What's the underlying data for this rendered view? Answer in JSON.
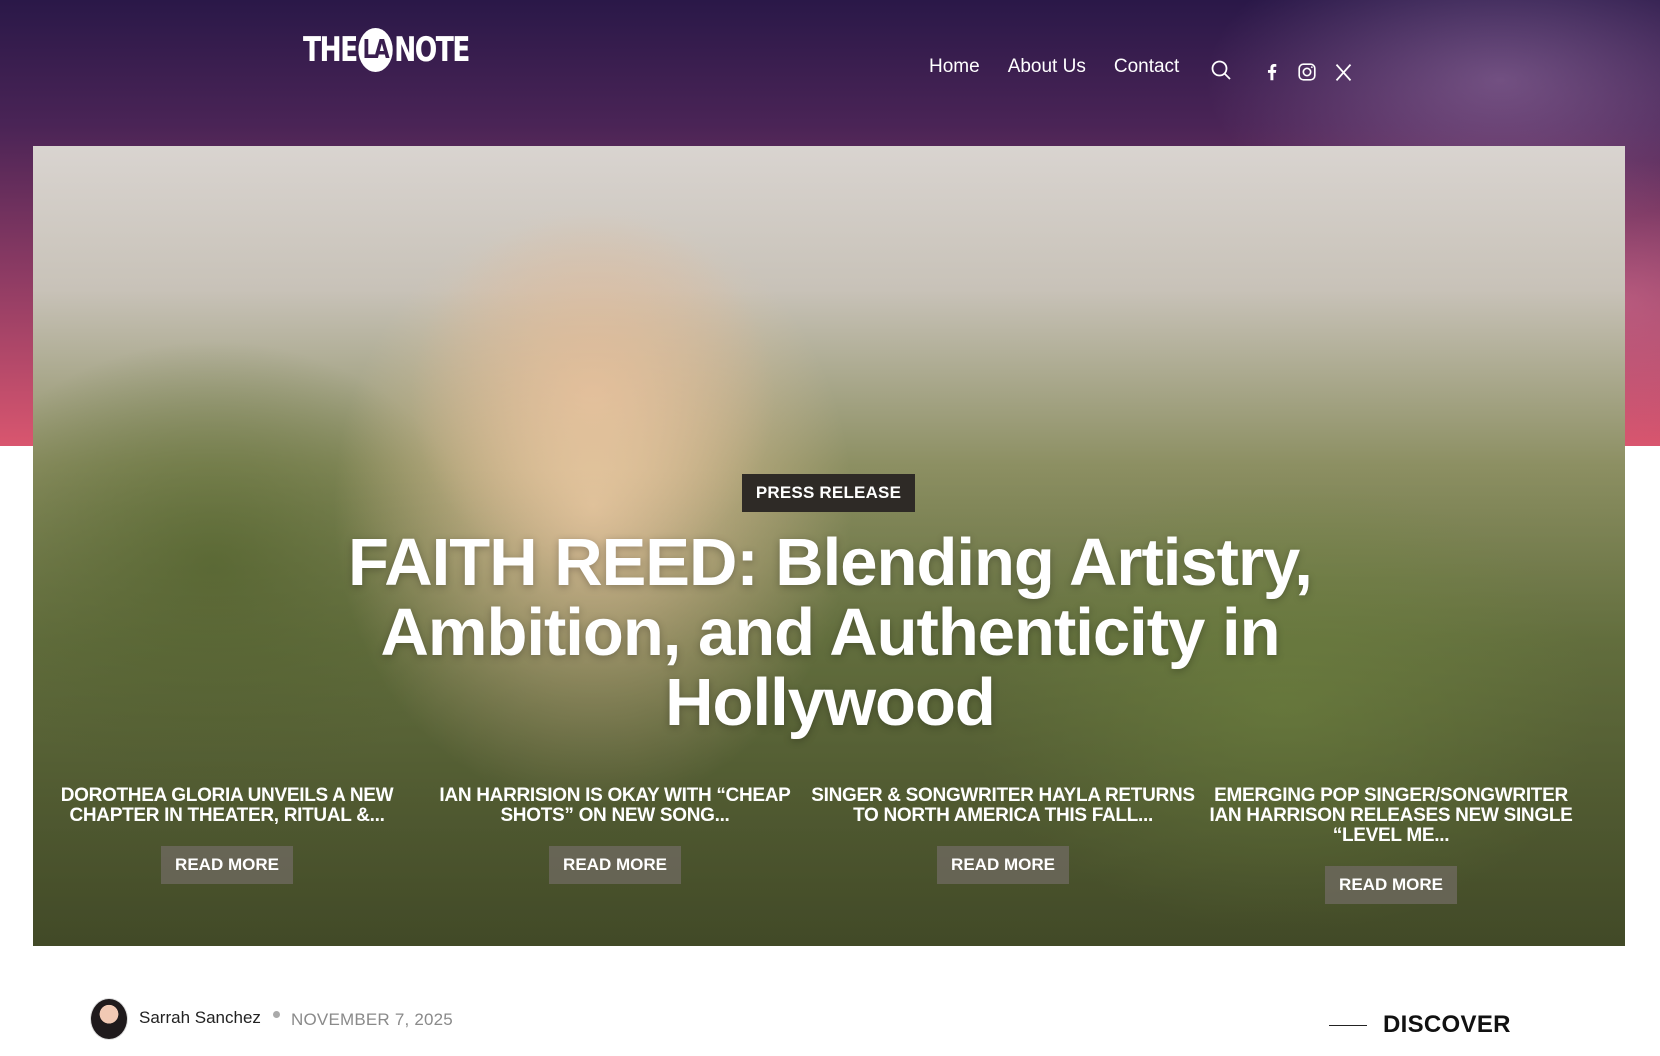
{
  "header": {
    "logo": {
      "left": "THE",
      "ring": "LA",
      "right": "NOTE"
    },
    "nav": [
      "Home",
      "About Us",
      "Contact"
    ],
    "icons": [
      "search-icon",
      "facebook-icon",
      "instagram-icon",
      "x-icon"
    ]
  },
  "hero": {
    "badge": "PRESS RELEASE",
    "title": "FAITH REED: Blending Artistry, Ambition, and Authenticity in Hollywood"
  },
  "cards": [
    {
      "title": "DOROTHEA GLORIA UNVEILS A NEW CHAPTER IN THEATER, RITUAL &...",
      "button": "READ MORE"
    },
    {
      "title": "IAN HARRISION IS OKAY WITH “CHEAP SHOTS” ON NEW SONG...",
      "button": "READ MORE"
    },
    {
      "title": "SINGER & SONGWRITER HAYLA RETURNS TO NORTH AMERICA THIS FALL...",
      "button": "READ MORE"
    },
    {
      "title": "EMERGING POP SINGER/SONGWRITER IAN HARRISON RELEASES NEW SINGLE “LEVEL ME...",
      "button": "READ MORE"
    }
  ],
  "byline": {
    "author": "Sarrah Sanchez",
    "date": "NOVEMBER 7, 2025"
  },
  "sidebar": {
    "heading": "DISCOVER"
  },
  "colors": {
    "header_top": "#2a1848",
    "header_bottom": "#d9566f",
    "badge_bg": "#2e2a26"
  }
}
